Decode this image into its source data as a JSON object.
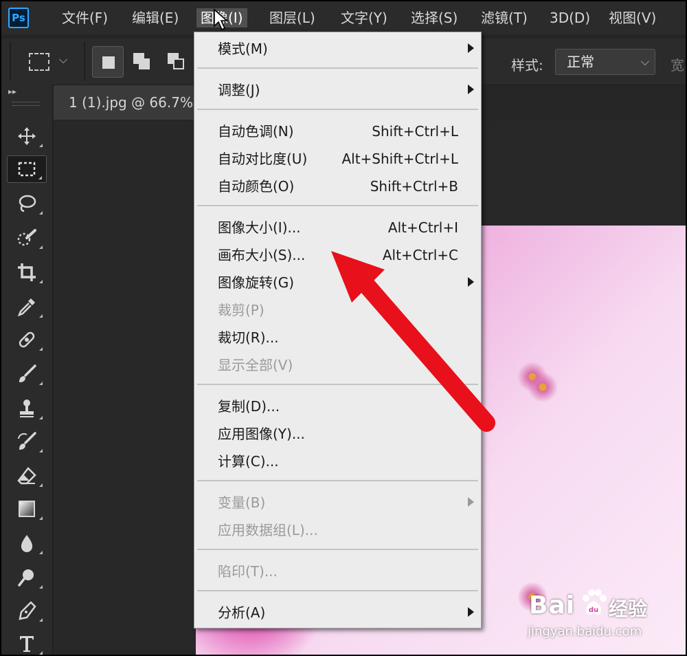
{
  "app": {
    "logo_text": "Ps"
  },
  "menubar": {
    "items": [
      "文件(F)",
      "编辑(E)",
      "图像(I)",
      "图层(L)",
      "文字(Y)",
      "选择(S)",
      "滤镜(T)",
      "3D(D)",
      "视图(V)"
    ],
    "active_index": 2
  },
  "options": {
    "style_label": "样式:",
    "style_value": "正常",
    "width_label": "宽"
  },
  "document": {
    "tab_title": "1 (1).jpg @ 66.7%"
  },
  "image_menu": {
    "groups": [
      [
        {
          "label": "模式(M)",
          "submenu": true
        }
      ],
      [
        {
          "label": "调整(J)",
          "submenu": true
        }
      ],
      [
        {
          "label": "自动色调(N)",
          "shortcut": "Shift+Ctrl+L"
        },
        {
          "label": "自动对比度(U)",
          "shortcut": "Alt+Shift+Ctrl+L"
        },
        {
          "label": "自动颜色(O)",
          "shortcut": "Shift+Ctrl+B"
        }
      ],
      [
        {
          "label": "图像大小(I)...",
          "shortcut": "Alt+Ctrl+I"
        },
        {
          "label": "画布大小(S)...",
          "shortcut": "Alt+Ctrl+C"
        },
        {
          "label": "图像旋转(G)",
          "submenu": true
        },
        {
          "label": "裁剪(P)",
          "disabled": true
        },
        {
          "label": "裁切(R)..."
        },
        {
          "label": "显示全部(V)",
          "disabled": true
        }
      ],
      [
        {
          "label": "复制(D)..."
        },
        {
          "label": "应用图像(Y)..."
        },
        {
          "label": "计算(C)..."
        }
      ],
      [
        {
          "label": "变量(B)",
          "submenu": true,
          "disabled": true
        },
        {
          "label": "应用数据组(L)...",
          "disabled": true
        }
      ],
      [
        {
          "label": "陷印(T)...",
          "disabled": true
        }
      ],
      [
        {
          "label": "分析(A)",
          "submenu": true
        }
      ]
    ]
  },
  "tools": [
    "move-icon",
    "marquee-icon",
    "lasso-icon",
    "quick-select-icon",
    "crop-icon",
    "eyedropper-icon",
    "healing-brush-icon",
    "brush-icon",
    "clone-stamp-icon",
    "history-brush-icon",
    "eraser-icon",
    "gradient-icon",
    "blur-icon",
    "dodge-icon",
    "pen-icon",
    "type-icon"
  ],
  "watermark": {
    "brand": "Bai",
    "brand_zh": "经验",
    "url": "jingyan.baidu.com"
  },
  "colors": {
    "annotation_arrow": "#e8101a",
    "ps_blue": "#31a8ff"
  }
}
